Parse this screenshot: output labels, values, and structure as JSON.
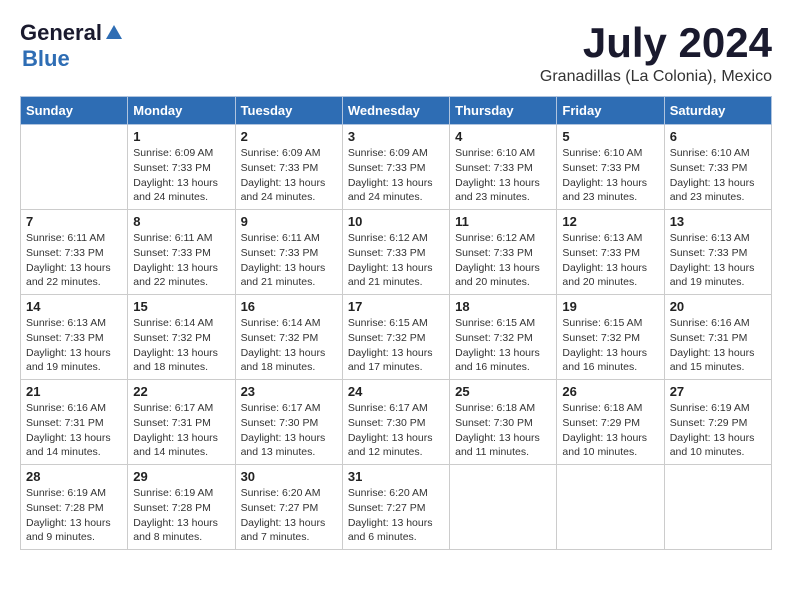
{
  "logo": {
    "general": "General",
    "blue": "Blue"
  },
  "title": "July 2024",
  "subtitle": "Granadillas (La Colonia), Mexico",
  "weekdays": [
    "Sunday",
    "Monday",
    "Tuesday",
    "Wednesday",
    "Thursday",
    "Friday",
    "Saturday"
  ],
  "weeks": [
    [
      {
        "day": "",
        "info": ""
      },
      {
        "day": "1",
        "info": "Sunrise: 6:09 AM\nSunset: 7:33 PM\nDaylight: 13 hours\nand 24 minutes."
      },
      {
        "day": "2",
        "info": "Sunrise: 6:09 AM\nSunset: 7:33 PM\nDaylight: 13 hours\nand 24 minutes."
      },
      {
        "day": "3",
        "info": "Sunrise: 6:09 AM\nSunset: 7:33 PM\nDaylight: 13 hours\nand 24 minutes."
      },
      {
        "day": "4",
        "info": "Sunrise: 6:10 AM\nSunset: 7:33 PM\nDaylight: 13 hours\nand 23 minutes."
      },
      {
        "day": "5",
        "info": "Sunrise: 6:10 AM\nSunset: 7:33 PM\nDaylight: 13 hours\nand 23 minutes."
      },
      {
        "day": "6",
        "info": "Sunrise: 6:10 AM\nSunset: 7:33 PM\nDaylight: 13 hours\nand 23 minutes."
      }
    ],
    [
      {
        "day": "7",
        "info": "Sunrise: 6:11 AM\nSunset: 7:33 PM\nDaylight: 13 hours\nand 22 minutes."
      },
      {
        "day": "8",
        "info": "Sunrise: 6:11 AM\nSunset: 7:33 PM\nDaylight: 13 hours\nand 22 minutes."
      },
      {
        "day": "9",
        "info": "Sunrise: 6:11 AM\nSunset: 7:33 PM\nDaylight: 13 hours\nand 21 minutes."
      },
      {
        "day": "10",
        "info": "Sunrise: 6:12 AM\nSunset: 7:33 PM\nDaylight: 13 hours\nand 21 minutes."
      },
      {
        "day": "11",
        "info": "Sunrise: 6:12 AM\nSunset: 7:33 PM\nDaylight: 13 hours\nand 20 minutes."
      },
      {
        "day": "12",
        "info": "Sunrise: 6:13 AM\nSunset: 7:33 PM\nDaylight: 13 hours\nand 20 minutes."
      },
      {
        "day": "13",
        "info": "Sunrise: 6:13 AM\nSunset: 7:33 PM\nDaylight: 13 hours\nand 19 minutes."
      }
    ],
    [
      {
        "day": "14",
        "info": "Sunrise: 6:13 AM\nSunset: 7:33 PM\nDaylight: 13 hours\nand 19 minutes."
      },
      {
        "day": "15",
        "info": "Sunrise: 6:14 AM\nSunset: 7:32 PM\nDaylight: 13 hours\nand 18 minutes."
      },
      {
        "day": "16",
        "info": "Sunrise: 6:14 AM\nSunset: 7:32 PM\nDaylight: 13 hours\nand 18 minutes."
      },
      {
        "day": "17",
        "info": "Sunrise: 6:15 AM\nSunset: 7:32 PM\nDaylight: 13 hours\nand 17 minutes."
      },
      {
        "day": "18",
        "info": "Sunrise: 6:15 AM\nSunset: 7:32 PM\nDaylight: 13 hours\nand 16 minutes."
      },
      {
        "day": "19",
        "info": "Sunrise: 6:15 AM\nSunset: 7:32 PM\nDaylight: 13 hours\nand 16 minutes."
      },
      {
        "day": "20",
        "info": "Sunrise: 6:16 AM\nSunset: 7:31 PM\nDaylight: 13 hours\nand 15 minutes."
      }
    ],
    [
      {
        "day": "21",
        "info": "Sunrise: 6:16 AM\nSunset: 7:31 PM\nDaylight: 13 hours\nand 14 minutes."
      },
      {
        "day": "22",
        "info": "Sunrise: 6:17 AM\nSunset: 7:31 PM\nDaylight: 13 hours\nand 14 minutes."
      },
      {
        "day": "23",
        "info": "Sunrise: 6:17 AM\nSunset: 7:30 PM\nDaylight: 13 hours\nand 13 minutes."
      },
      {
        "day": "24",
        "info": "Sunrise: 6:17 AM\nSunset: 7:30 PM\nDaylight: 13 hours\nand 12 minutes."
      },
      {
        "day": "25",
        "info": "Sunrise: 6:18 AM\nSunset: 7:30 PM\nDaylight: 13 hours\nand 11 minutes."
      },
      {
        "day": "26",
        "info": "Sunrise: 6:18 AM\nSunset: 7:29 PM\nDaylight: 13 hours\nand 10 minutes."
      },
      {
        "day": "27",
        "info": "Sunrise: 6:19 AM\nSunset: 7:29 PM\nDaylight: 13 hours\nand 10 minutes."
      }
    ],
    [
      {
        "day": "28",
        "info": "Sunrise: 6:19 AM\nSunset: 7:28 PM\nDaylight: 13 hours\nand 9 minutes."
      },
      {
        "day": "29",
        "info": "Sunrise: 6:19 AM\nSunset: 7:28 PM\nDaylight: 13 hours\nand 8 minutes."
      },
      {
        "day": "30",
        "info": "Sunrise: 6:20 AM\nSunset: 7:27 PM\nDaylight: 13 hours\nand 7 minutes."
      },
      {
        "day": "31",
        "info": "Sunrise: 6:20 AM\nSunset: 7:27 PM\nDaylight: 13 hours\nand 6 minutes."
      },
      {
        "day": "",
        "info": ""
      },
      {
        "day": "",
        "info": ""
      },
      {
        "day": "",
        "info": ""
      }
    ]
  ]
}
